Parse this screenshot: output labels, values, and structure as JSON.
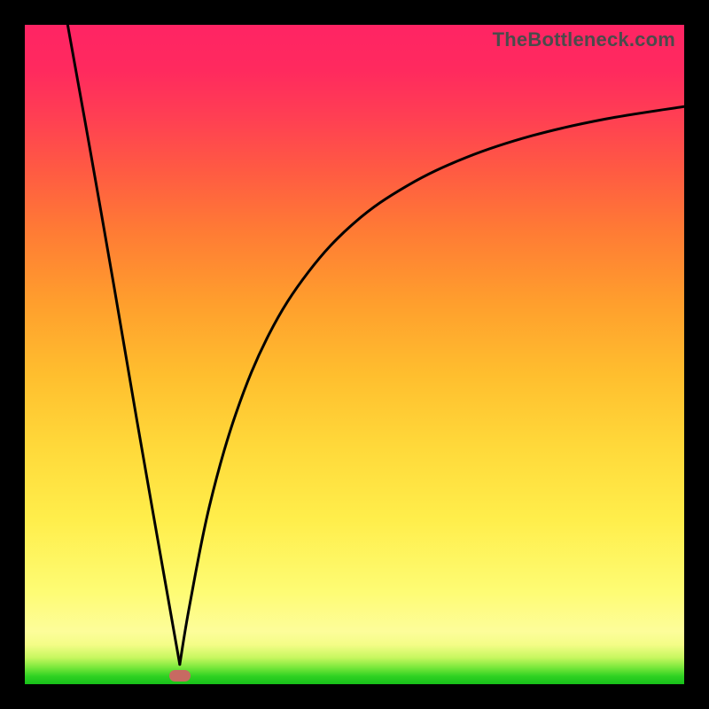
{
  "watermark": "TheBottleneck.com",
  "colors": {
    "frame": "#000000",
    "curve": "#000000",
    "marker": "#c76a62"
  },
  "chart_data": {
    "type": "line",
    "title": "",
    "xlabel": "",
    "ylabel": "",
    "xlim": [
      0,
      100
    ],
    "ylim": [
      0,
      100
    ],
    "series": [
      {
        "name": "left-branch",
        "x": [
          6.5,
          10,
          13.5,
          17,
          20.5,
          23.5
        ],
        "y": [
          100,
          80.5,
          60.5,
          40,
          20,
          3
        ]
      },
      {
        "name": "right-branch",
        "x": [
          23.5,
          25,
          28,
          32,
          37,
          43,
          50,
          58,
          67,
          77,
          88,
          100
        ],
        "y": [
          3,
          12,
          27,
          41,
          53,
          62.5,
          70,
          75.6,
          79.9,
          83.2,
          85.7,
          87.6
        ]
      }
    ],
    "marker": {
      "x": 23.5,
      "y": 1.3
    },
    "grid": false,
    "legend": false
  }
}
